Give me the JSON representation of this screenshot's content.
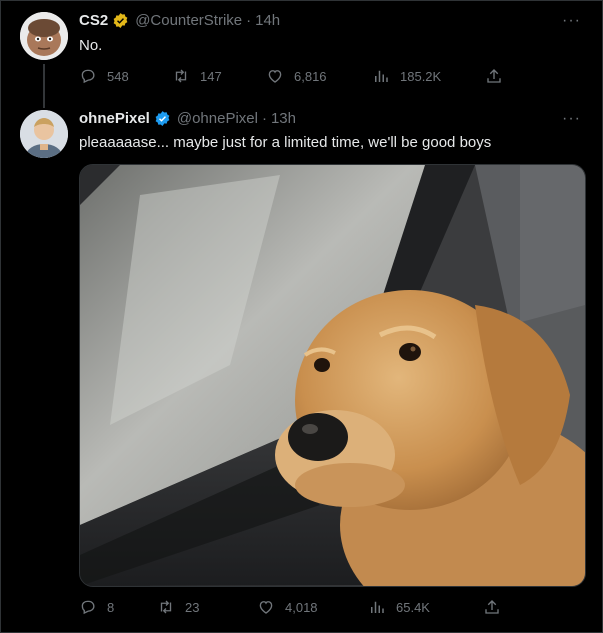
{
  "tweets": [
    {
      "name": "CS2",
      "handle": "@CounterStrike",
      "sep": "·",
      "time": "14h",
      "text": "No.",
      "stats": {
        "replies": "548",
        "retweets": "147",
        "likes": "6,816",
        "views": "185.2K"
      }
    },
    {
      "name": "ohnePixel",
      "handle": "@ohnePixel",
      "sep": "·",
      "time": "13h",
      "text": "pleaaaaase... maybe just for a limited time, we'll be good boys",
      "stats": {
        "replies": "8",
        "retweets": "23",
        "likes": "4,018",
        "views": "65.4K"
      }
    }
  ],
  "more_label": "···",
  "colors": {
    "bg": "#000000",
    "text": "#e7e9ea",
    "muted": "#71767b",
    "gold_badge": "#e2b719",
    "blue_badge": "#1d9bf0"
  }
}
